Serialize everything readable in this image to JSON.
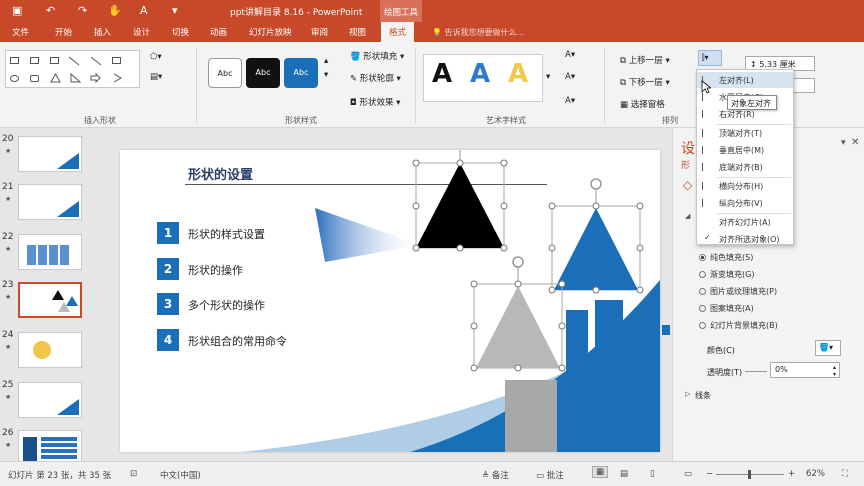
{
  "titlebar": {
    "title": "ppt讲解目录 8.16  -  PowerPoint",
    "context_tools": "绘图工具",
    "brand_color": "#c8482a"
  },
  "tabs": [
    "文件",
    "开始",
    "插入",
    "设计",
    "切换",
    "动画",
    "幻灯片放映",
    "审阅",
    "视图",
    "格式"
  ],
  "active_tab": "格式",
  "tell_me": "告诉我您想要做什么...",
  "ribbon": {
    "insert_shapes_label": "插入形状",
    "shape_styles_label": "形状样式",
    "style_preset_text": "Abc",
    "shape_fill": "形状填充",
    "shape_outline": "形状轮廓",
    "shape_effects": "形状效果",
    "wordart_label": "艺术字样式",
    "wordart_glyph": "A",
    "bring_forward": "上移一层",
    "send_backward": "下移一层",
    "selection_pane": "选择窗格",
    "arrange_label": "排列",
    "height_value": "5.33 厘米"
  },
  "align_menu": {
    "items": [
      "左对齐(L)",
      "水平居中(C)",
      "右对齐(R)",
      "顶端对齐(T)",
      "垂直居中(M)",
      "底端对齐(B)",
      "横向分布(H)",
      "纵向分布(V)",
      "对齐幻灯片(A)",
      "对齐所选对象(O)"
    ],
    "tooltip": "对象左对齐"
  },
  "thumbnails": [
    "20",
    "21",
    "22",
    "23",
    "24",
    "25",
    "26"
  ],
  "active_slide": "23",
  "slide": {
    "title": "形状的设置",
    "items": [
      {
        "num": "1",
        "text": "形状的样式设置"
      },
      {
        "num": "2",
        "text": "形状的操作"
      },
      {
        "num": "3",
        "text": "多个形状的操作"
      },
      {
        "num": "4",
        "text": "形状组合的常用命令"
      }
    ],
    "accent": "#1a6fb8"
  },
  "format_pane": {
    "title_partial": "设",
    "sub_partial": "形",
    "fill_options": [
      "纯色填充(S)",
      "渐变填充(G)",
      "图片或纹理填充(P)",
      "图案填充(A)",
      "幻灯片背景填充(B)"
    ],
    "selected_fill": "纯色填充(S)",
    "color_label": "颜色(C)",
    "transparency_label": "透明度(T)",
    "transparency_value": "0%",
    "line_label": "线条"
  },
  "statusbar": {
    "slide_info": "幻灯片 第 23 张，共 35 张",
    "language": "中文(中国)",
    "notes": "备注",
    "comments": "批注",
    "zoom": "62%"
  }
}
